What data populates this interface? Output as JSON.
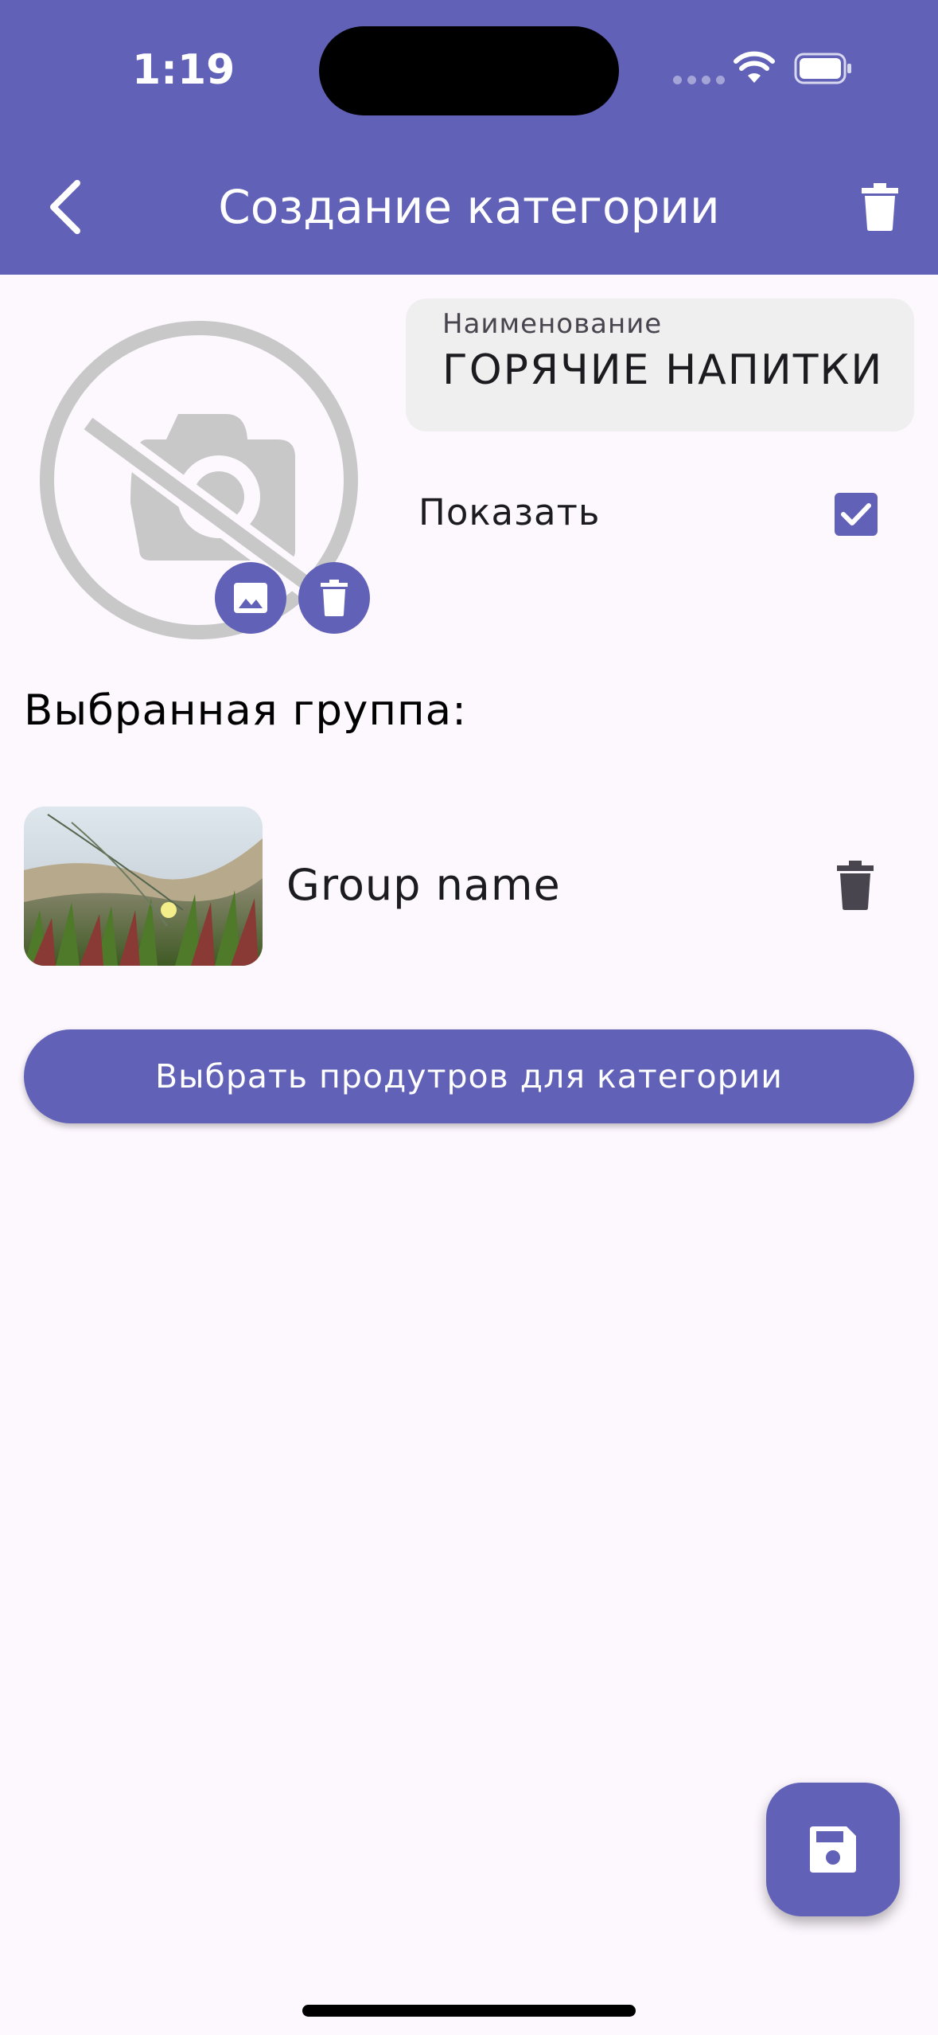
{
  "status_bar": {
    "time": "1:19"
  },
  "app_bar": {
    "title": "Создание категории"
  },
  "form": {
    "name_label": "Наименование",
    "name_value": "ГОРЯЧИЕ НАПИТКИ",
    "show_label": "Показать",
    "show_checked": true
  },
  "group_section": {
    "heading": "Выбранная группа:",
    "group_name": "Group name"
  },
  "select_products_button": "Выбрать продутров для категории",
  "icons": {
    "back": "arrow-back-icon",
    "delete": "trash-icon",
    "placeholder": "no-camera-icon",
    "pick_image": "image-icon",
    "save": "floppy-disk-icon"
  },
  "colors": {
    "primary": "#6161b8",
    "background": "#fdf7fe",
    "field_background": "#f0efef",
    "placeholder_gray": "#c8c8c8"
  }
}
